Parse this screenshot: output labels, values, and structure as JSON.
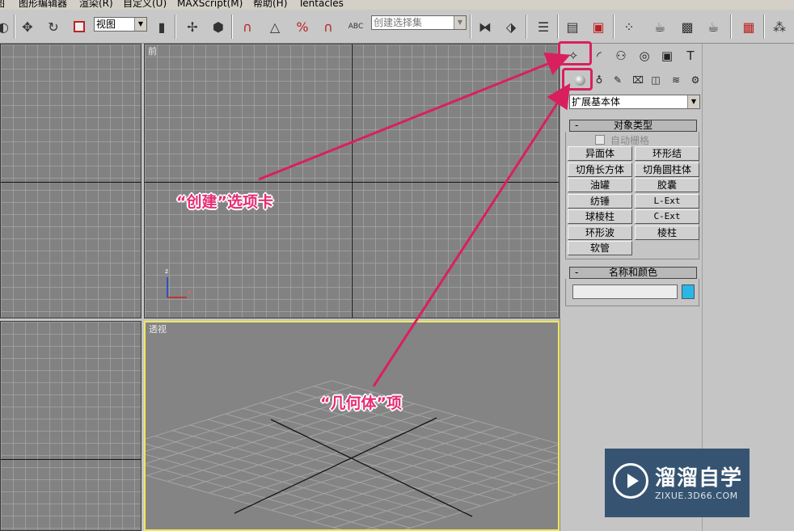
{
  "menu": [
    "图形编辑器",
    "渲染(R)",
    "自定义(U)",
    "MAXScript(M)",
    "帮助(H)",
    "Tentacles"
  ],
  "toolbar": {
    "view_dropdown": "视图",
    "selection_set_placeholder": "创建选择集",
    "icons": [
      "move-icon",
      "rotate-icon",
      "scale-icon",
      "snap-3d-icon",
      "angle-snap-icon",
      "percent-snap-icon",
      "spinner-snap-icon",
      "mirror-icon",
      "align-icon",
      "layers-icon",
      "curve-editor-icon",
      "schematic-icon",
      "material-editor-icon",
      "render-setup-icon",
      "render-icon",
      "teapot-icon"
    ]
  },
  "viewports": {
    "front": {
      "label": "前"
    },
    "perspective": {
      "label": "透视"
    },
    "axis": {
      "z": "z",
      "x": "x"
    }
  },
  "command_panel": {
    "tabs": [
      "create-tab-icon",
      "modify-tab-icon",
      "hierarchy-tab-icon",
      "motion-tab-icon",
      "display-tab-icon",
      "utilities-tab-icon"
    ],
    "subtabs": [
      "geometry-icon",
      "shapes-icon",
      "lights-icon",
      "cameras-icon",
      "helpers-icon",
      "spacewarps-icon",
      "systems-icon"
    ],
    "category_dropdown": "扩展基本体",
    "object_type": {
      "title": "对象类型",
      "collapse": "-",
      "autogrid_label": "自动栅格",
      "buttons": [
        "异面体",
        "环形结",
        "切角长方体",
        "切角圆柱体",
        "油罐",
        "胶囊",
        "纺锤",
        "L-Ext",
        "球棱柱",
        "C-Ext",
        "环形波",
        "棱柱",
        "软管"
      ]
    },
    "name_color": {
      "title": "名称和颜色",
      "collapse": "-",
      "name_value": "",
      "color": "#29b7e8"
    }
  },
  "annotations": {
    "create_tab": "“创建”选项卡",
    "geometry": "“几何体”项"
  },
  "watermark": {
    "title": "溜溜自学",
    "subtitle": "ZIXUE.3D66.COM"
  },
  "colors": {
    "annotation": "#e62d74",
    "highlight": "#d9205e",
    "active_viewport_border": "#f0e85a"
  }
}
